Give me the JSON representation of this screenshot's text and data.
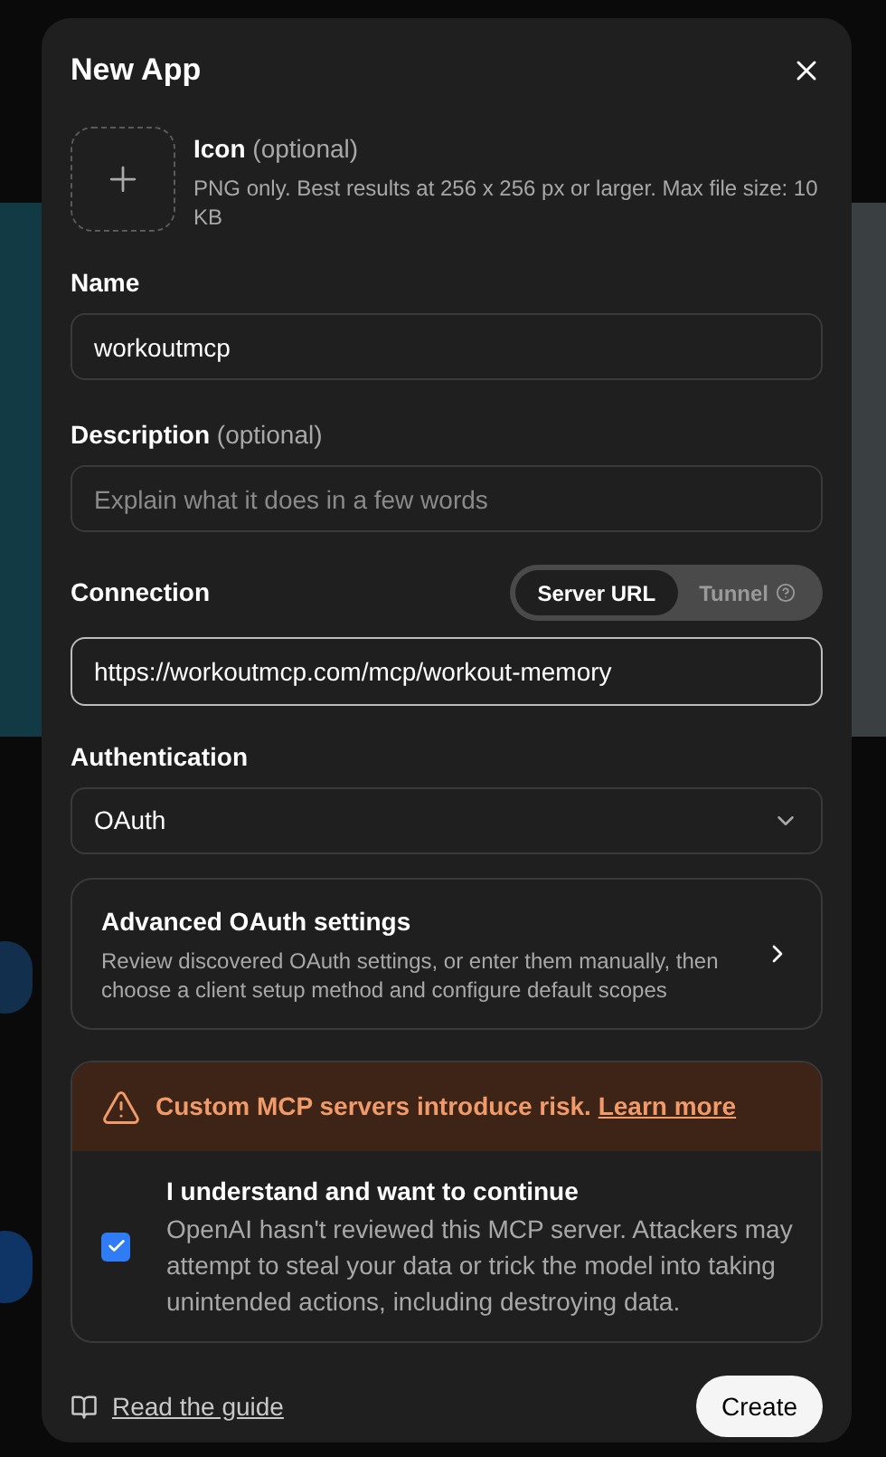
{
  "dialog": {
    "title": "New App",
    "icon_upload": {
      "label": "Icon",
      "hint": "(optional)",
      "help": "PNG only. Best results at 256 x 256 px or larger. Max file size: 10 KB"
    },
    "name": {
      "label": "Name",
      "value": "workoutmcp"
    },
    "description": {
      "label": "Description",
      "hint": "(optional)",
      "placeholder": "Explain what it does in a few words"
    },
    "connection": {
      "label": "Connection",
      "modes": [
        {
          "label": "Server URL",
          "selected": true,
          "help": false
        },
        {
          "label": "Tunnel",
          "selected": false,
          "help": true
        }
      ],
      "value": "https://workoutmcp.com/mcp/workout-memory"
    },
    "authentication": {
      "label": "Authentication",
      "value": "OAuth"
    },
    "advanced": {
      "title": "Advanced OAuth settings",
      "text": "Review discovered OAuth settings, or enter them manually, then choose a client setup method and configure default scopes"
    },
    "warning": {
      "text": "Custom MCP servers introduce risk.",
      "link": "Learn more",
      "consent": {
        "checked": true,
        "title": "I understand and want to continue",
        "text": "OpenAI hasn't reviewed this MCP server. Attackers may attempt to steal your data or trick the model into taking unintended actions, including destroying data."
      }
    },
    "footer": {
      "guide_link": "Read the guide",
      "create_button": "Create"
    }
  }
}
